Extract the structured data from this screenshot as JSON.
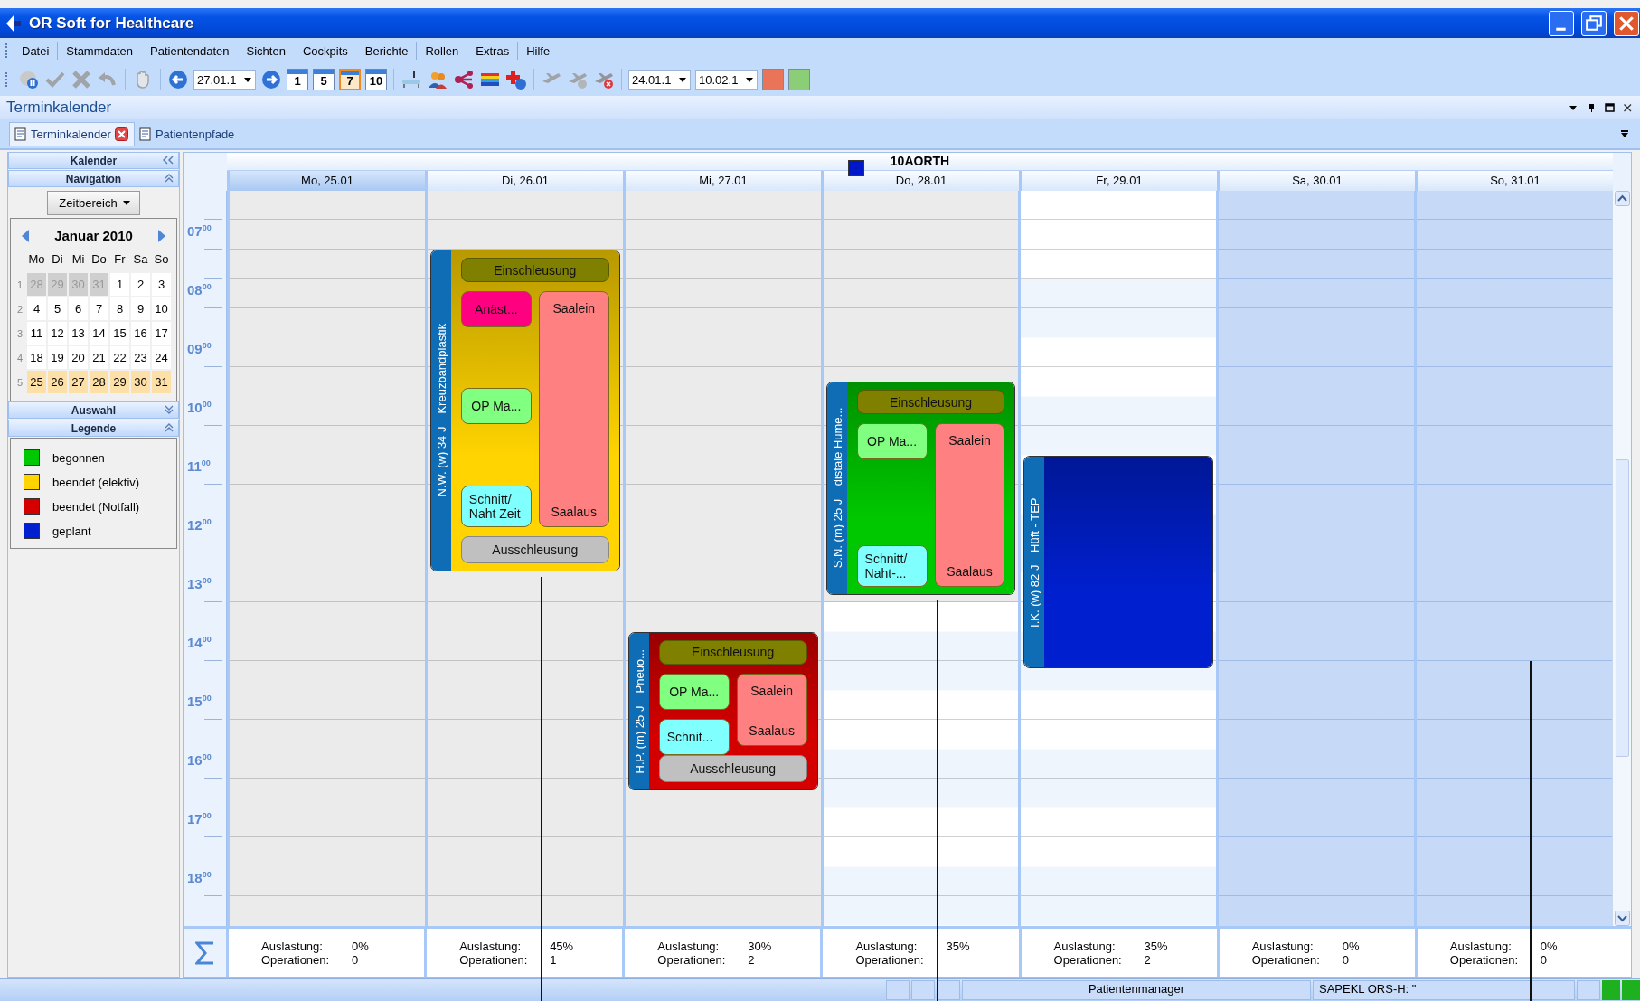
{
  "window": {
    "title": "OR Soft for Healthcare"
  },
  "menu": [
    {
      "label": "Datei",
      "separated": true
    },
    {
      "label": "Stammdaten",
      "separated": false
    },
    {
      "label": "Patientendaten",
      "separated": false
    },
    {
      "label": "Sichten",
      "separated": false
    },
    {
      "label": "Cockpits",
      "separated": false
    },
    {
      "label": "Berichte",
      "separated": true
    },
    {
      "label": "Rollen",
      "separated": true
    },
    {
      "label": "Extras",
      "separated": true
    },
    {
      "label": "Hilfe",
      "separated": false
    }
  ],
  "toolbar": [
    {
      "kind": "icon",
      "disabled": false
    },
    {
      "kind": "icon",
      "disabled": true
    },
    {
      "kind": "icon",
      "disabled": true
    },
    {
      "kind": "icon",
      "disabled": true
    },
    {
      "kind": "separator"
    },
    {
      "kind": "icon",
      "disabled": true
    },
    {
      "kind": "separator"
    },
    {
      "kind": "icon",
      "disabled": false
    },
    {
      "kind": "date",
      "value": "27.01.1"
    },
    {
      "kind": "icon",
      "disabled": false
    },
    {
      "kind": "view",
      "label": "1",
      "selected": false
    },
    {
      "kind": "view",
      "label": "5",
      "selected": false
    },
    {
      "kind": "view",
      "label": "7",
      "selected": true
    },
    {
      "kind": "view",
      "label": "10",
      "selected": false
    },
    {
      "kind": "separator"
    },
    {
      "kind": "icon",
      "disabled": false
    },
    {
      "kind": "icon",
      "disabled": false
    },
    {
      "kind": "icon",
      "disabled": false
    },
    {
      "kind": "icon",
      "disabled": false
    },
    {
      "kind": "icon",
      "disabled": false
    },
    {
      "kind": "separator"
    },
    {
      "kind": "icon",
      "disabled": true
    },
    {
      "kind": "icon",
      "disabled": true
    },
    {
      "kind": "icon",
      "disabled": true
    },
    {
      "kind": "separator"
    },
    {
      "kind": "date",
      "value": "24.01.1"
    },
    {
      "kind": "date",
      "value": "10.02.1"
    },
    {
      "kind": "color",
      "color": "#ea7458"
    },
    {
      "kind": "color",
      "color": "#8ccd77"
    }
  ],
  "panel": {
    "title": "Terminkalender"
  },
  "tabs": [
    {
      "label": "Terminkalender",
      "selected": true,
      "closable": true
    },
    {
      "label": "Patientenpfade",
      "selected": false,
      "closable": false
    }
  ],
  "sidebar": {
    "title": "Kalender",
    "navigation": {
      "title": "Navigation",
      "expanded": true,
      "range_button": "Zeitbereich",
      "month": "Januar 2010",
      "weekdays": [
        "Mo",
        "Di",
        "Mi",
        "Do",
        "Fr",
        "Sa",
        "So"
      ],
      "weeks": [
        {
          "number": "1",
          "days": [
            {
              "label": "28",
              "dimmed": true,
              "selected": false
            },
            {
              "label": "29",
              "dimmed": true,
              "selected": false
            },
            {
              "label": "30",
              "dimmed": true,
              "selected": false
            },
            {
              "label": "31",
              "dimmed": true,
              "selected": false
            },
            {
              "label": "1",
              "dimmed": false,
              "selected": false
            },
            {
              "label": "2",
              "dimmed": false,
              "selected": false
            },
            {
              "label": "3",
              "dimmed": false,
              "selected": false
            }
          ]
        },
        {
          "number": "2",
          "days": [
            {
              "label": "4",
              "dimmed": false,
              "selected": false
            },
            {
              "label": "5",
              "dimmed": false,
              "selected": false
            },
            {
              "label": "6",
              "dimmed": false,
              "selected": false
            },
            {
              "label": "7",
              "dimmed": false,
              "selected": false
            },
            {
              "label": "8",
              "dimmed": false,
              "selected": false
            },
            {
              "label": "9",
              "dimmed": false,
              "selected": false
            },
            {
              "label": "10",
              "dimmed": false,
              "selected": false
            }
          ]
        },
        {
          "number": "3",
          "days": [
            {
              "label": "11",
              "dimmed": false,
              "selected": false
            },
            {
              "label": "12",
              "dimmed": false,
              "selected": false
            },
            {
              "label": "13",
              "dimmed": false,
              "selected": false
            },
            {
              "label": "14",
              "dimmed": false,
              "selected": false
            },
            {
              "label": "15",
              "dimmed": false,
              "selected": false
            },
            {
              "label": "16",
              "dimmed": false,
              "selected": false
            },
            {
              "label": "17",
              "dimmed": false,
              "selected": false
            }
          ]
        },
        {
          "number": "4",
          "days": [
            {
              "label": "18",
              "dimmed": false,
              "selected": false
            },
            {
              "label": "19",
              "dimmed": false,
              "selected": false
            },
            {
              "label": "20",
              "dimmed": false,
              "selected": false
            },
            {
              "label": "21",
              "dimmed": false,
              "selected": false
            },
            {
              "label": "22",
              "dimmed": false,
              "selected": false
            },
            {
              "label": "23",
              "dimmed": false,
              "selected": false
            },
            {
              "label": "24",
              "dimmed": false,
              "selected": false
            }
          ]
        },
        {
          "number": "5",
          "days": [
            {
              "label": "25",
              "dimmed": false,
              "selected": true
            },
            {
              "label": "26",
              "dimmed": false,
              "selected": true
            },
            {
              "label": "27",
              "dimmed": false,
              "selected": true
            },
            {
              "label": "28",
              "dimmed": false,
              "selected": true
            },
            {
              "label": "29",
              "dimmed": false,
              "selected": true
            },
            {
              "label": "30",
              "dimmed": false,
              "selected": true
            },
            {
              "label": "31",
              "dimmed": false,
              "selected": true
            }
          ]
        }
      ]
    },
    "selection": {
      "title": "Auswahl",
      "expanded": false
    },
    "legend": {
      "title": "Legende",
      "expanded": true,
      "items": [
        {
          "label": "begonnen",
          "color": "#00c800"
        },
        {
          "label": "beendet (elektiv)",
          "color": "#ffd400"
        },
        {
          "label": "beendet (Notfall)",
          "color": "#d40000"
        },
        {
          "label": "geplant",
          "color": "#0020d0"
        }
      ]
    }
  },
  "calendar": {
    "room": "10AORTH",
    "time_labels": [
      "07$^{00}$",
      "08$^{00}$",
      "09$^{00}$",
      "10$^{00}$",
      "11$^{00}$",
      "12$^{00}$",
      "13$^{00}$",
      "14$^{00}$",
      "15$^{00}$",
      "16$^{00}$",
      "17$^{00}$",
      "18$^{00}$"
    ],
    "days": [
      {
        "label": "Mo, 25.01",
        "selected": true,
        "kind": "past",
        "summary": [
          {
            "label": "Auslastung:",
            "value": "0%"
          },
          {
            "label": "Operationen:",
            "value": "0"
          }
        ]
      },
      {
        "label": "Di, 26.01",
        "selected": false,
        "kind": "past",
        "marker": true,
        "summary": [
          {
            "label": "Auslastung:",
            "value": "45%"
          },
          {
            "label": "Operationen:",
            "value": "1"
          }
        ],
        "operations": [
          {
            "patient": "N.W. (w) 34 J",
            "procedure": "Kreuzbandplastik",
            "color": "#ffd400",
            "steps": [
              {
                "kind": "einschleusung",
                "label": "Einschleusung"
              },
              {
                "kind": "anaesthesie",
                "label": "Anäst..."
              },
              {
                "kind": "op",
                "label": "OP Ma..."
              },
              {
                "kind": "schnitt",
                "label": "Schnitt/ Naht Zeit"
              },
              {
                "kind": "saal",
                "start": "Saalein",
                "end": "Saalaus"
              },
              {
                "kind": "ausschleusung",
                "label": "Ausschleusung"
              }
            ]
          }
        ]
      },
      {
        "label": "Mi, 27.01",
        "selected": false,
        "kind": "past",
        "summary": [
          {
            "label": "Auslastung:",
            "value": "30%"
          },
          {
            "label": "Operationen:",
            "value": "2"
          }
        ],
        "operations": [
          {
            "patient": "H.P. (m) 25 J",
            "procedure": "Pneuo...",
            "color": "#d40000",
            "steps": [
              {
                "kind": "einschleusung",
                "label": "Einschleusung"
              },
              {
                "kind": "op",
                "label": "OP Ma..."
              },
              {
                "kind": "saal",
                "start": "Saalein",
                "end": "Saalaus"
              },
              {
                "kind": "schnitt",
                "label": "Schnit..."
              },
              {
                "kind": "ausschleusung",
                "label": "Ausschleusung"
              }
            ]
          }
        ]
      },
      {
        "label": "Do, 28.01",
        "selected": false,
        "kind": "today",
        "marker": true,
        "summary": [
          {
            "label": "Auslastung:",
            "value": "35%"
          },
          {
            "label": "Operationen:"
          }
        ],
        "operations": [
          {
            "patient": "S.N. (m) 25 J",
            "procedure": "distale Hume...",
            "color": "#00c800",
            "steps": [
              {
                "kind": "einschleusung",
                "label": "Einschleusung"
              },
              {
                "kind": "op",
                "label": "OP Ma..."
              },
              {
                "kind": "schnitt",
                "label": "Schnitt/ Naht-..."
              },
              {
                "kind": "saal",
                "start": "Saalein",
                "end": "Saalaus"
              }
            ]
          }
        ]
      },
      {
        "label": "Fr, 29.01",
        "selected": false,
        "kind": "future",
        "summary": [
          {
            "label": "Auslastung:",
            "value": "35%"
          },
          {
            "label": "Operationen:",
            "value": "2"
          }
        ],
        "operations": [
          {
            "patient": "I.K. (w) 82 J",
            "procedure": "Hüft - TEP",
            "color": "#0020d0"
          }
        ]
      },
      {
        "label": "Sa, 30.01",
        "selected": false,
        "kind": "weekend",
        "summary": [
          {
            "label": "Auslastung:",
            "value": "0%"
          },
          {
            "label": "Operationen:",
            "value": "0"
          }
        ]
      },
      {
        "label": "So, 31.01",
        "selected": false,
        "kind": "weekend",
        "marker": true,
        "summary": [
          {
            "label": "Auslastung:",
            "value": "0%"
          },
          {
            "label": "Operationen:",
            "value": "0"
          }
        ]
      }
    ]
  },
  "status_bar": {
    "panels": [
      {
        "text": "Patientenmanager"
      },
      {
        "text": "SAPEKL ORS-H: \""
      }
    ],
    "indicators": [
      {
        "on": true
      },
      {
        "on": true
      }
    ]
  }
}
